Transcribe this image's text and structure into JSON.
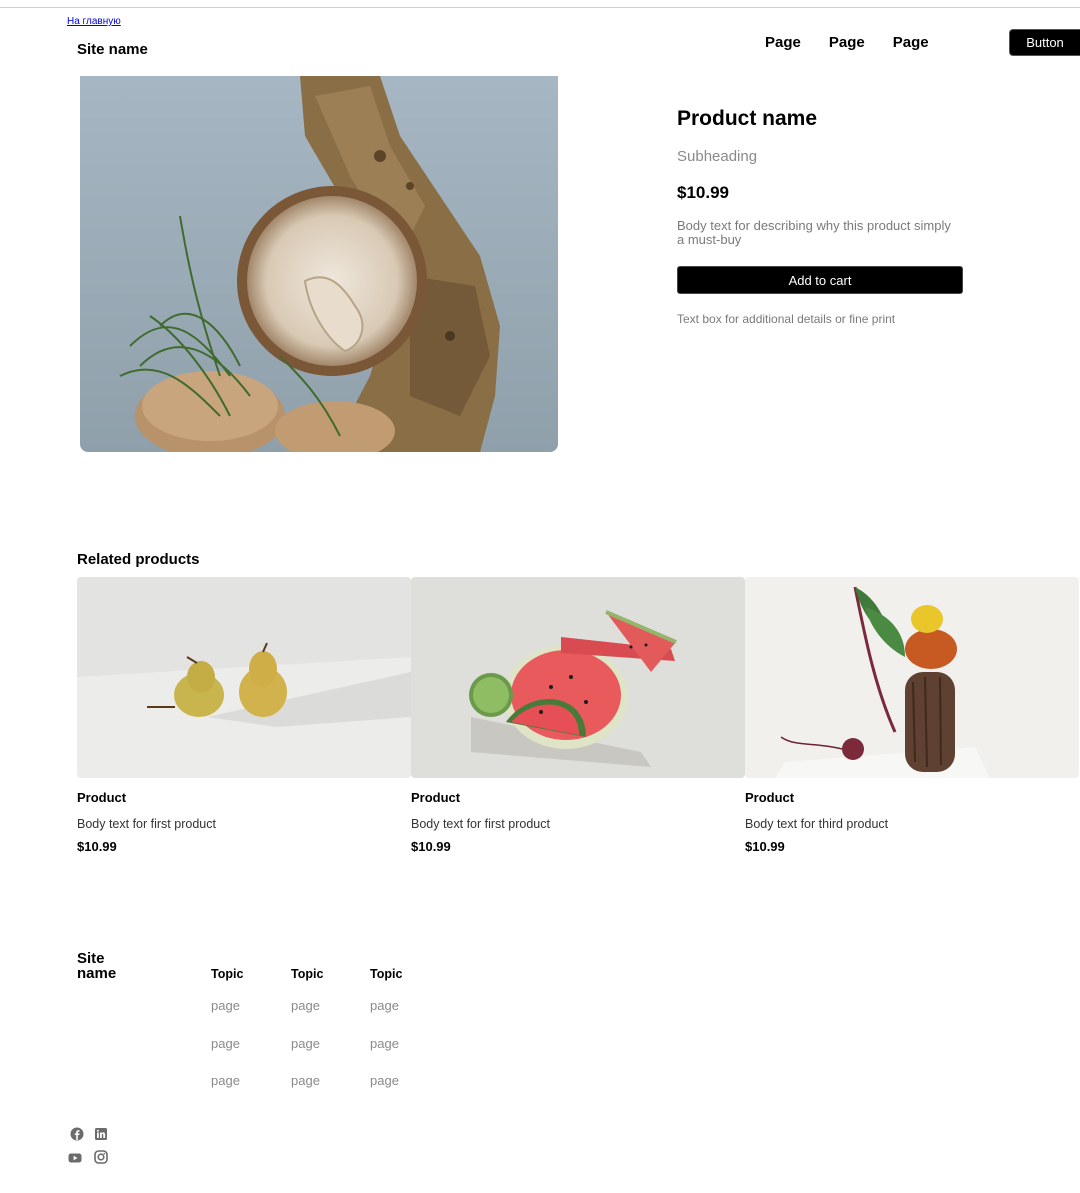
{
  "header": {
    "back_link": "На главную",
    "site_name": "Site name",
    "nav": [
      "Page",
      "Page",
      "Page"
    ],
    "button_label": "Button"
  },
  "product": {
    "name": "Product name",
    "subheading": "Subheading",
    "price": "$10.99",
    "body": "Body text for describing why this product simply a must-buy",
    "add_to_cart": "Add to cart",
    "fine_print": "Text box for additional details or fine print",
    "image": "mushroom-on-bark-photo"
  },
  "related": {
    "title": "Related products",
    "items": [
      {
        "name": "Product",
        "body": "Body text for first product",
        "price": "$10.99",
        "image": "pears-photo"
      },
      {
        "name": "Product",
        "body": "Body text for first product",
        "price": "$10.99",
        "image": "watermelon-photo"
      },
      {
        "name": "Product",
        "body": "Body text for third product",
        "price": "$10.99",
        "image": "beet-pumpkin-bread-photo"
      }
    ]
  },
  "footer": {
    "site_name": "Site name",
    "columns": [
      {
        "topic": "Topic",
        "links": [
          "page",
          "page",
          "page"
        ]
      },
      {
        "topic": "Topic",
        "links": [
          "page",
          "page",
          "page"
        ]
      },
      {
        "topic": "Topic",
        "links": [
          "page",
          "page",
          "page"
        ]
      }
    ],
    "social_icons": [
      "facebook-icon",
      "linkedin-icon",
      "youtube-icon",
      "instagram-icon"
    ]
  },
  "colors": {
    "button_bg": "#000000",
    "muted_text": "#8a8a8a"
  }
}
